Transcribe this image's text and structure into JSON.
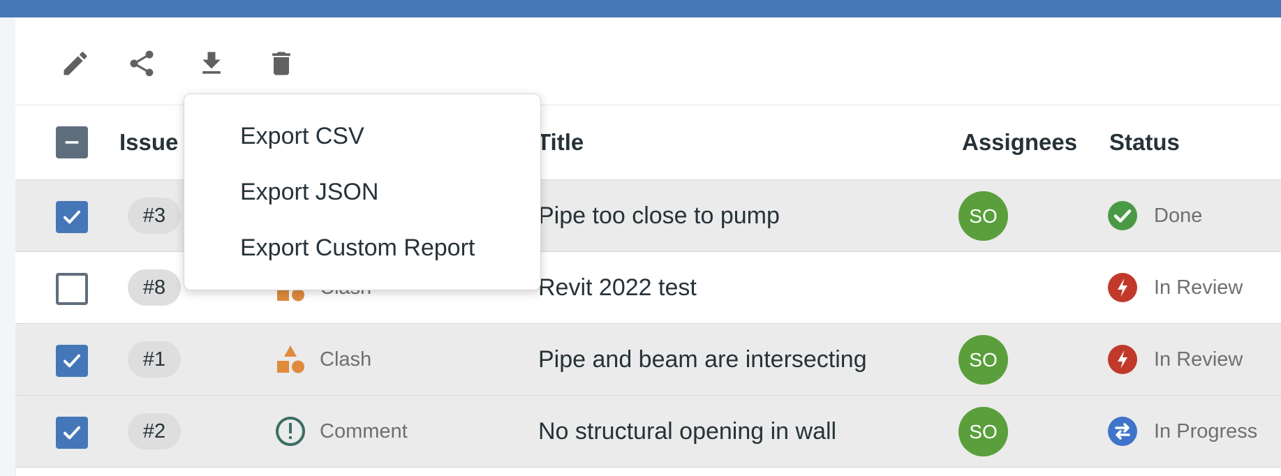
{
  "toolbar": {
    "tools": [
      {
        "name": "pencil-icon"
      },
      {
        "name": "share-icon"
      },
      {
        "name": "download-icon"
      },
      {
        "name": "trash-icon"
      }
    ]
  },
  "export_menu": {
    "items": [
      "Export CSV",
      "Export JSON",
      "Export Custom Report"
    ]
  },
  "table": {
    "columns": {
      "issue": "Issue",
      "title": "Title",
      "assignees": "Assignees",
      "status": "Status"
    },
    "header_checkbox_state": "indeterminate",
    "rows": [
      {
        "selected": true,
        "number": "#3",
        "type": "",
        "type_icon": "",
        "title": "Pipe too close to pump",
        "assignee": "SO",
        "status": "Done",
        "status_icon": "check-circle-icon",
        "status_color": "#4a9a45"
      },
      {
        "selected": false,
        "number": "#8",
        "type": "Clash",
        "type_icon": "clash-shapes-icon",
        "title": "Revit 2022 test",
        "assignee": "",
        "status": "In Review",
        "status_icon": "bolt-circle-icon",
        "status_color": "#c0392b"
      },
      {
        "selected": true,
        "number": "#1",
        "type": "Clash",
        "type_icon": "clash-shapes-icon",
        "title": "Pipe and beam are intersecting",
        "assignee": "SO",
        "status": "In Review",
        "status_icon": "bolt-circle-icon",
        "status_color": "#c0392b"
      },
      {
        "selected": true,
        "number": "#2",
        "type": "Comment",
        "type_icon": "comment-alert-icon",
        "title": "No structural opening in wall",
        "assignee": "SO",
        "status": "In Progress",
        "status_icon": "swap-circle-icon",
        "status_color": "#3f74c9"
      }
    ]
  },
  "colors": {
    "topbar": "#4577b8",
    "checkbox_checked": "#4577b8",
    "avatar": "#5a9f3c",
    "clash_orange": "#e08a3c",
    "comment_teal": "#3c6e63"
  }
}
